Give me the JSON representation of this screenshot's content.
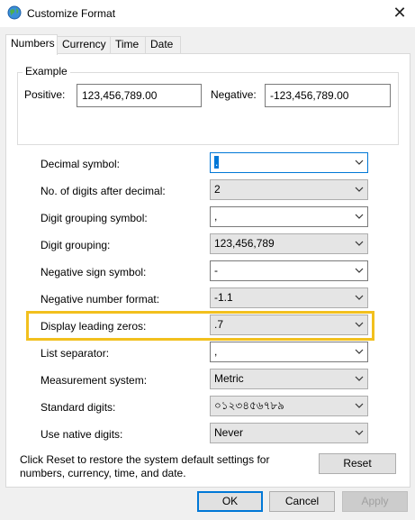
{
  "window": {
    "title": "Customize Format",
    "close_label": "✕"
  },
  "tabs": [
    {
      "label": "Numbers",
      "active": true
    },
    {
      "label": "Currency",
      "active": false
    },
    {
      "label": "Time",
      "active": false
    },
    {
      "label": "Date",
      "active": false
    }
  ],
  "example": {
    "group_label": "Example",
    "positive_label": "Positive:",
    "positive_value": "123,456,789.00",
    "negative_label": "Negative:",
    "negative_value": "-123,456,789.00"
  },
  "settings": [
    {
      "label": "Decimal symbol:",
      "value": ".",
      "editable": true,
      "focused": true
    },
    {
      "label": "No. of digits after decimal:",
      "value": "2",
      "editable": false
    },
    {
      "label": "Digit grouping symbol:",
      "value": ",",
      "editable": true
    },
    {
      "label": "Digit grouping:",
      "value": "123,456,789",
      "editable": false
    },
    {
      "label": "Negative sign symbol:",
      "value": "-",
      "editable": true
    },
    {
      "label": "Negative number format:",
      "value": "-1.1",
      "editable": false
    },
    {
      "label": "Display leading zeros:",
      "value": ".7",
      "editable": false,
      "highlighted": true
    },
    {
      "label": "List separator:",
      "value": ",",
      "editable": true
    },
    {
      "label": "Measurement system:",
      "value": "Metric",
      "editable": false
    },
    {
      "label": "Standard digits:",
      "value": "০১২৩৪৫৬৭৮৯",
      "editable": false
    },
    {
      "label": "Use native digits:",
      "value": "Never",
      "editable": false
    }
  ],
  "reset_note": "Click Reset to restore the system default settings for numbers, currency, time, and date.",
  "buttons": {
    "reset": "Reset",
    "ok": "OK",
    "cancel": "Cancel",
    "apply": "Apply"
  },
  "colors": {
    "highlight": "#f2c01e",
    "focus": "#0078d7"
  }
}
